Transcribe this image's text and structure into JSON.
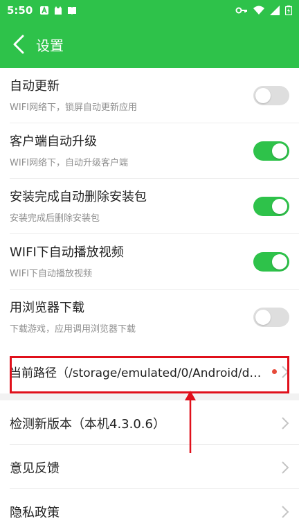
{
  "status_bar": {
    "time": "5:50",
    "notification_icons": [
      "font-a-icon",
      "cat-icon",
      "book-icon"
    ],
    "right_icons": [
      "key-icon",
      "wifi-icon",
      "signal-icon",
      "battery-icon"
    ]
  },
  "appbar": {
    "title": "设置"
  },
  "toggles": [
    {
      "title": "自动更新",
      "subtitle": "WIFI网络下，锁屏自动更新应用",
      "on": false
    },
    {
      "title": "客户端自动升级",
      "subtitle": "WIFI网络下，自动升级客户端",
      "on": true
    },
    {
      "title": "安装完成自动删除安装包",
      "subtitle": "安装完成后删除安装包",
      "on": true
    },
    {
      "title": "WIFI下自动播放视频",
      "subtitle": "WIFI下自动播放视频",
      "on": true
    },
    {
      "title": "用浏览器下载",
      "subtitle": "下载游戏，应用调用浏览器下载",
      "on": false
    }
  ],
  "path": {
    "label": "当前路径（/storage/emulated/0/Android/da..."
  },
  "links": [
    {
      "label": "检测新版本（本机4.3.0.6）"
    },
    {
      "label": "意见反馈"
    },
    {
      "label": "隐私政策"
    }
  ],
  "colors": {
    "brand_green": "#2ec24a",
    "highlight_red": "#e0101b",
    "badge_dot": "#e64a3a"
  }
}
